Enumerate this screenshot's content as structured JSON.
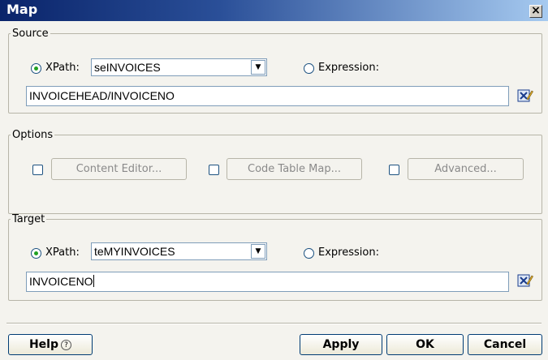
{
  "window": {
    "title": "Map",
    "close_glyph": "×"
  },
  "source": {
    "legend": "Source",
    "xpath_label": "XPath:",
    "xpath_value": "seINVOICES",
    "expression_label": "Expression:",
    "path_value": "INVOICEHEAD/INVOICENO"
  },
  "options": {
    "legend": "Options",
    "content_editor": "Content Editor...",
    "code_table_map": "Code Table Map...",
    "advanced": "Advanced..."
  },
  "target": {
    "legend": "Target",
    "xpath_label": "XPath:",
    "xpath_value": "teMYINVOICES",
    "expression_label": "Expression:",
    "path_value": "INVOICENO"
  },
  "buttons": {
    "help": "Help",
    "help_glyph": "?",
    "apply": "Apply",
    "ok": "OK",
    "cancel": "Cancel"
  },
  "icons": {
    "combo_arrow": "chevron-down-icon",
    "edit": "xpath-edit-icon",
    "help": "help-icon"
  }
}
